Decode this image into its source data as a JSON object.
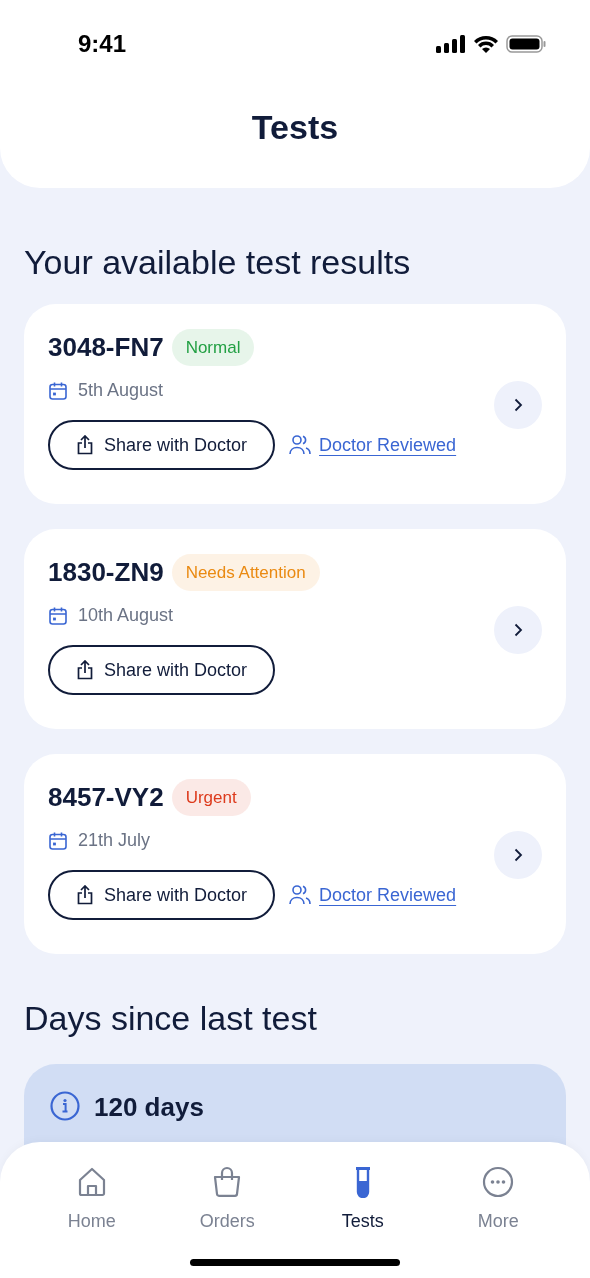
{
  "status_bar": {
    "time": "9:41"
  },
  "header": {
    "title": "Tests"
  },
  "results": {
    "title": "Your available test results",
    "items": [
      {
        "code": "3048-FN7",
        "status": "Normal",
        "color": "#23a044",
        "date": "5th August",
        "share_label": "Share with Doctor",
        "reviewed_label": "Doctor Reviewed"
      },
      {
        "code": "1830-ZN9",
        "status": "Needs Attention",
        "color": "#ea8a12",
        "date": "10th August",
        "share_label": "Share with Doctor"
      },
      {
        "code": "8457-VY2",
        "status": "Urgent",
        "color": "#dd3a1c",
        "date": "21th July",
        "share_label": "Share with Doctor",
        "reviewed_label": "Doctor Reviewed"
      }
    ]
  },
  "days_since": {
    "title": "Days since last test",
    "value": "120 days"
  },
  "tab_bar": [
    {
      "label": "Home",
      "selected": false
    },
    {
      "label": "Orders",
      "selected": false
    },
    {
      "label": "Tests",
      "selected": true
    },
    {
      "label": "More",
      "selected": false
    }
  ]
}
